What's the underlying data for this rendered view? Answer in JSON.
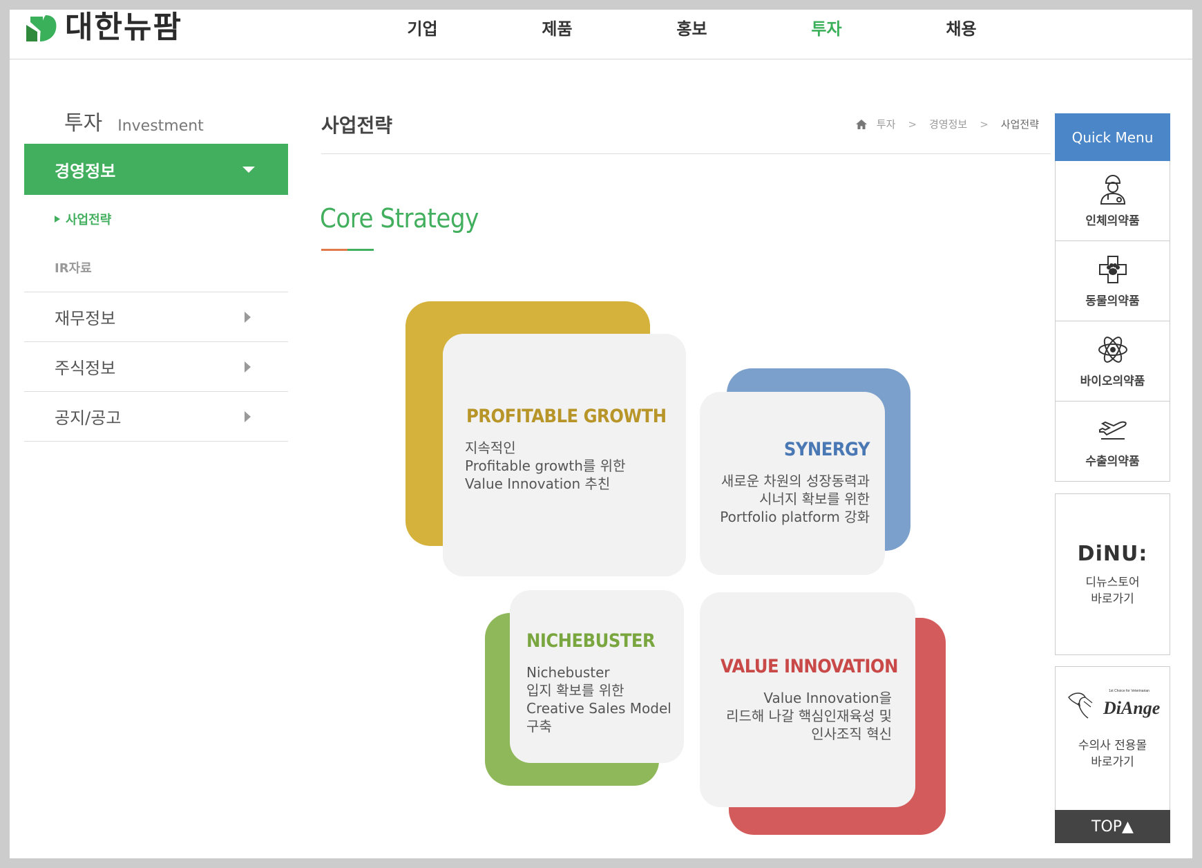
{
  "header": {
    "logo_text": "대한뉴팜",
    "nav": [
      "기업",
      "제품",
      "홍보",
      "투자",
      "채용"
    ],
    "active_index": 3,
    "brand_green": "#3bb05a"
  },
  "sidebar": {
    "title": "투자",
    "subtitle": "Investment",
    "active_section": "경영정보",
    "sub_items": [
      "사업전략",
      "IR자료"
    ],
    "menu": [
      "재무정보",
      "주식정보",
      "공지/공고"
    ]
  },
  "content": {
    "page_title": "사업전략",
    "breadcrumb": [
      "투자",
      "경영정보",
      "사업전략"
    ],
    "heading": "Core Strategy"
  },
  "strategy": {
    "profitable": {
      "title": "PROFITABLE GROWTH",
      "desc": "지속적인\nProfitable growth를 위한\nValue Innovation 추친",
      "color": "#d4b23c"
    },
    "synergy": {
      "title": "SYNERGY",
      "desc": "새로운 차원의 성장동력과\n시너지 확보를 위한\nPortfolio platform 강화",
      "color": "#7ba0cc"
    },
    "nichebuster": {
      "title": "NICHEBUSTER",
      "desc": "Nichebuster\n입지 확보를 위한\nCreative Sales Model\n구축",
      "color": "#8fb85a"
    },
    "value": {
      "title": "VALUE INNOVATION",
      "desc": "Value Innovation을\n리드해 나갈 핵심인재육성 및\n인사조직 혁신",
      "color": "#d45b5b"
    }
  },
  "quick_menu": {
    "title": "Quick Menu",
    "items": [
      "인체의약품",
      "동물의약품",
      "바이오의약품",
      "수출의약품"
    ],
    "dinu_logo": "DiNU:",
    "dinu_text": "디뉴스토어\n바로가기",
    "diange_small": "1st Choice for Veterinarian",
    "diange_logo": "DiAnge",
    "diange_text": "수의사 전용몰\n바로가기",
    "top": "TOP▲",
    "color": "#4a86c8"
  }
}
